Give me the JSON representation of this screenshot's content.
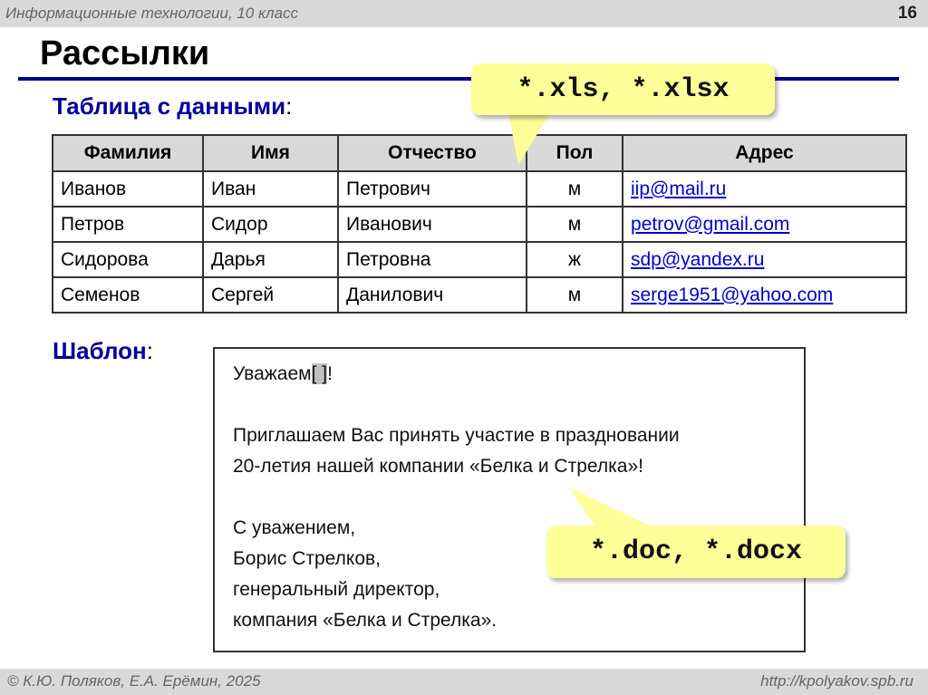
{
  "header": {
    "course": "Информационные технологии, 10 класс",
    "page": "16"
  },
  "title": "Рассылки",
  "table_section": {
    "label": "Таблица с данными",
    "colon": ":",
    "columns": [
      "Фамилия",
      "Имя",
      "Отчество",
      "Пол",
      "Адрес"
    ],
    "rows": [
      [
        "Иванов",
        "Иван",
        "Петрович",
        "м",
        "iip@mail.ru"
      ],
      [
        "Петров",
        "Сидор",
        "Иванович",
        "м",
        "petrov@gmail.com"
      ],
      [
        "Сидорова",
        "Дарья",
        "Петровна",
        "ж",
        "sdp@yandex.ru"
      ],
      [
        "Семенов",
        "Сергей",
        "Данилович",
        "м",
        "serge1951@yahoo.com"
      ]
    ]
  },
  "template_section": {
    "label": "Шаблон",
    "colon": ":",
    "greeting": "Уважаем",
    "placeholder": "[ ]",
    "greeting_end": "!",
    "line1": "Приглашаем Вас принять участие в праздновании",
    "line2": "20-летия нашей компании «Белка и Стрелка»!",
    "sign1": "С уважением,",
    "sign2": "Борис Стрелков,",
    "sign3": "генеральный директор,",
    "sign4": "компания «Белка и Стрелка»."
  },
  "callouts": {
    "table_formats": "*.xls, *.xlsx",
    "doc_formats": "*.doc, *.docx"
  },
  "footer": {
    "authors": "© К.Ю. Поляков, Е.А. Ерёмин, 2025",
    "url": "http://kpolyakov.spb.ru"
  },
  "colors": {
    "accent": "#000080",
    "callout": "#ffff99",
    "bar": "#d9d9d9"
  }
}
